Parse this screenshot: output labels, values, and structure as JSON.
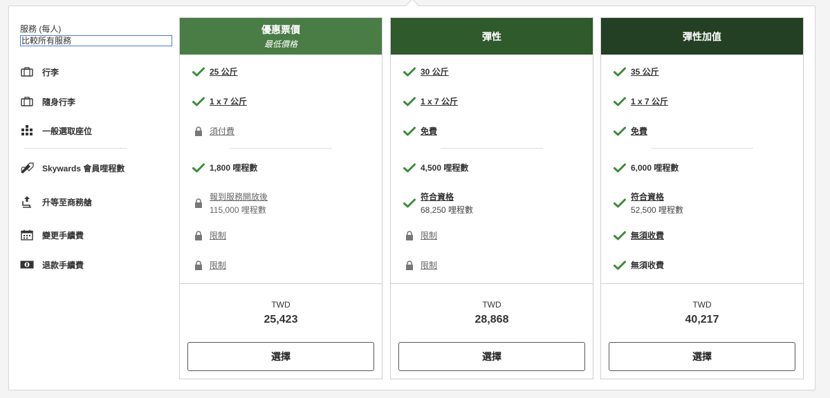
{
  "side": {
    "header_title": "服務 (每人)",
    "compare_link": "比較所有服務",
    "rows": [
      {
        "label": "行李",
        "icon": "baggage-icon"
      },
      {
        "label": "隨身行李",
        "icon": "cabin-bag-icon"
      },
      {
        "label": "一般選取座位",
        "icon": "seat-icon"
      },
      {
        "label": "Skywards 會員哩程數",
        "icon": "skywards-plane-icon"
      },
      {
        "label": "升等至商務艙",
        "icon": "upgrade-seat-icon"
      },
      {
        "label": "變更手續費",
        "icon": "calendar-icon"
      },
      {
        "label": "退款手續費",
        "icon": "money-icon"
      }
    ]
  },
  "columns": [
    {
      "name": "優惠票價",
      "subtitle": "最低價格",
      "color": "#4a7c45",
      "baggage": "25 公斤",
      "cabin_bag": "1 x 7 公斤",
      "seat": "須付費",
      "miles": "1,800 哩程數",
      "upgrade": "報到服務開放後",
      "upgrade_sub": "115,000 哩程數",
      "change_fee": "限制",
      "refund_fee": "限制",
      "currency": "TWD",
      "price": "25,423",
      "button": "選擇"
    },
    {
      "name": "彈性",
      "subtitle": "",
      "color": "#2f5a2c",
      "baggage": "30 公斤",
      "cabin_bag": "1 x 7 公斤",
      "seat": "免費",
      "miles": "4,500 哩程數",
      "upgrade": "符合資格",
      "upgrade_sub": "68,250 哩程數",
      "change_fee": "限制",
      "refund_fee": "限制",
      "currency": "TWD",
      "price": "28,868",
      "button": "選擇"
    },
    {
      "name": "彈性加值",
      "subtitle": "",
      "color": "#233f24",
      "baggage": "35 公斤",
      "cabin_bag": "1 x 7 公斤",
      "seat": "免費",
      "miles": "6,000 哩程數",
      "upgrade": "符合資格",
      "upgrade_sub": "52,500 哩程數",
      "change_fee": "無須收費",
      "refund_fee": "無須收費",
      "currency": "TWD",
      "price": "40,217",
      "button": "選擇"
    }
  ],
  "colors": {
    "check": "#3c8a3c",
    "lock": "#777777"
  }
}
